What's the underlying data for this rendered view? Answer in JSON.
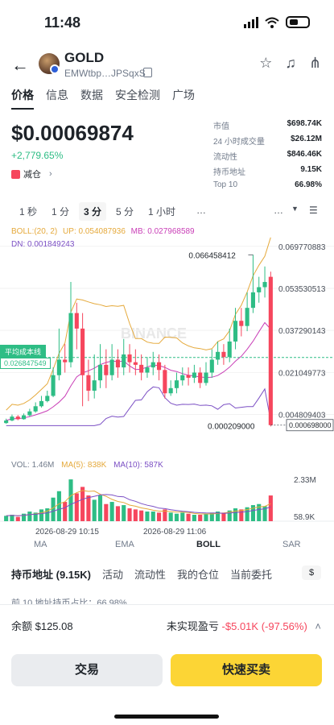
{
  "status": {
    "time": "11:48"
  },
  "header": {
    "coin_name": "GOLD",
    "address": "EMWtbp…JPSqxS"
  },
  "tabs": [
    "价格",
    "信息",
    "数据",
    "安全检测",
    "广场"
  ],
  "price": {
    "value": "$0.00069874",
    "change": "+2,779.65%",
    "reduce_label": "减仓"
  },
  "stats": [
    {
      "k": "市值",
      "v": "$698.74K"
    },
    {
      "k": "24 小时成交量",
      "v": "$26.12M"
    },
    {
      "k": "流动性",
      "v": "$846.46K"
    },
    {
      "k": "持币地址",
      "v": "9.15K"
    },
    {
      "k": "Top 10",
      "v": "66.98%"
    }
  ],
  "intervals": {
    "i1": "1 秒",
    "i2": "1 分",
    "i3": "3 分",
    "i4": "5 分",
    "i5": "1 小时",
    "more": "…",
    "more2": "…"
  },
  "chart": {
    "boll": "BOLL:(20, 2)",
    "up": "UP: 0.054087936",
    "mb": "MB: 0.027968589",
    "dn": "DN: 0.001849243",
    "high_label": "0.066458412",
    "low_label": "0.000209000",
    "current_tag": "0.000698000",
    "avg_cost_label": "平均成本线",
    "avg_cost_value": "0.026847549",
    "axis": [
      "0.069770883",
      "0.053530513",
      "0.037290143",
      "0.021049773",
      "0.004809403"
    ],
    "vol": "VOL: 1.46M",
    "ma5": "MA(5): 838K",
    "ma10": "MA(10): 587K",
    "vol_axis_top": "2.33M",
    "vol_axis_bottom": "58.9K",
    "time1": "2026-08-29 10:15",
    "time2": "2026-08-29 11:06",
    "watermark": "BINANCE",
    "colors": {
      "up": "#2ebd85",
      "down": "#f6465d",
      "upband": "#e5a93b",
      "mb": "#c93fb7",
      "dn": "#7b4fc4"
    }
  },
  "chart_data": {
    "type": "candlestick",
    "candles": [
      [
        0.0015,
        0.0025,
        0.0032,
        0.0012
      ],
      [
        0.0025,
        0.004,
        0.0048,
        0.0022
      ],
      [
        0.004,
        0.003,
        0.0046,
        0.0026
      ],
      [
        0.003,
        0.0045,
        0.0052,
        0.0028
      ],
      [
        0.0045,
        0.006,
        0.007,
        0.004
      ],
      [
        0.006,
        0.008,
        0.0095,
        0.0055
      ],
      [
        0.008,
        0.01,
        0.012,
        0.0075
      ],
      [
        0.01,
        0.012,
        0.014,
        0.0095
      ],
      [
        0.012,
        0.02,
        0.023,
        0.0115
      ],
      [
        0.02,
        0.026,
        0.038,
        0.018
      ],
      [
        0.026,
        0.025,
        0.032,
        0.021
      ],
      [
        0.025,
        0.044,
        0.056,
        0.023
      ],
      [
        0.044,
        0.038,
        0.048,
        0.03
      ],
      [
        0.038,
        0.02,
        0.044,
        0.008
      ],
      [
        0.02,
        0.014,
        0.026,
        0.01
      ],
      [
        0.014,
        0.018,
        0.028,
        0.011
      ],
      [
        0.018,
        0.024,
        0.032,
        0.015
      ],
      [
        0.024,
        0.02,
        0.03,
        0.015
      ],
      [
        0.02,
        0.026,
        0.032,
        0.018
      ],
      [
        0.026,
        0.023,
        0.03,
        0.019
      ],
      [
        0.023,
        0.028,
        0.034,
        0.02
      ],
      [
        0.028,
        0.025,
        0.032,
        0.021
      ],
      [
        0.025,
        0.024,
        0.03,
        0.02
      ],
      [
        0.024,
        0.021,
        0.028,
        0.018
      ],
      [
        0.021,
        0.023,
        0.027,
        0.019
      ],
      [
        0.023,
        0.025,
        0.029,
        0.02
      ],
      [
        0.025,
        0.022,
        0.028,
        0.018
      ],
      [
        0.022,
        0.013,
        0.024,
        0.011
      ],
      [
        0.013,
        0.015,
        0.018,
        0.012
      ],
      [
        0.015,
        0.018,
        0.021,
        0.013
      ],
      [
        0.018,
        0.02,
        0.023,
        0.016
      ],
      [
        0.02,
        0.019,
        0.023,
        0.016
      ],
      [
        0.019,
        0.021,
        0.024,
        0.017
      ],
      [
        0.021,
        0.017,
        0.023,
        0.015
      ],
      [
        0.017,
        0.021,
        0.025,
        0.016
      ],
      [
        0.021,
        0.026,
        0.03,
        0.019
      ],
      [
        0.026,
        0.029,
        0.033,
        0.024
      ],
      [
        0.029,
        0.027,
        0.032,
        0.024
      ],
      [
        0.027,
        0.033,
        0.038,
        0.025
      ],
      [
        0.033,
        0.041,
        0.046,
        0.03
      ],
      [
        0.041,
        0.039,
        0.046,
        0.035
      ],
      [
        0.039,
        0.046,
        0.052,
        0.037
      ],
      [
        0.046,
        0.052,
        0.0665,
        0.044
      ],
      [
        0.052,
        0.054,
        0.058,
        0.048
      ],
      [
        0.054,
        0.056,
        0.062,
        0.05
      ],
      [
        0.058,
        0.0007,
        0.06,
        0.0002
      ]
    ],
    "volumes": [
      0.25,
      0.3,
      0.2,
      0.35,
      0.45,
      0.4,
      0.55,
      0.6,
      1.1,
      1.4,
      0.9,
      1.95,
      1.3,
      1.6,
      1.2,
      1.0,
      1.2,
      0.8,
      0.9,
      0.7,
      0.75,
      0.6,
      0.55,
      0.5,
      0.45,
      0.45,
      0.4,
      0.55,
      0.4,
      0.35,
      0.4,
      0.35,
      0.3,
      0.3,
      0.35,
      0.4,
      0.45,
      0.4,
      0.5,
      0.6,
      0.55,
      0.65,
      0.75,
      0.8,
      0.7,
      1.2
    ],
    "ylim": [
      0.0,
      0.0722
    ]
  },
  "indicators": {
    "ma": "MA",
    "ema": "EMA",
    "boll": "BOLL",
    "sar": "SAR"
  },
  "sub_tabs": [
    "持币地址 (9.15K)",
    "活动",
    "流动性",
    "我的仓位",
    "当前委托"
  ],
  "top10_text": "前 10 地址持币占比：66.98%",
  "balance": {
    "label": "余额 $125.08",
    "pnl_label": "未实现盈亏",
    "pnl_value": "-$5.01K (-97.56%)"
  },
  "buttons": {
    "trade": "交易",
    "quick": "快速买卖"
  }
}
